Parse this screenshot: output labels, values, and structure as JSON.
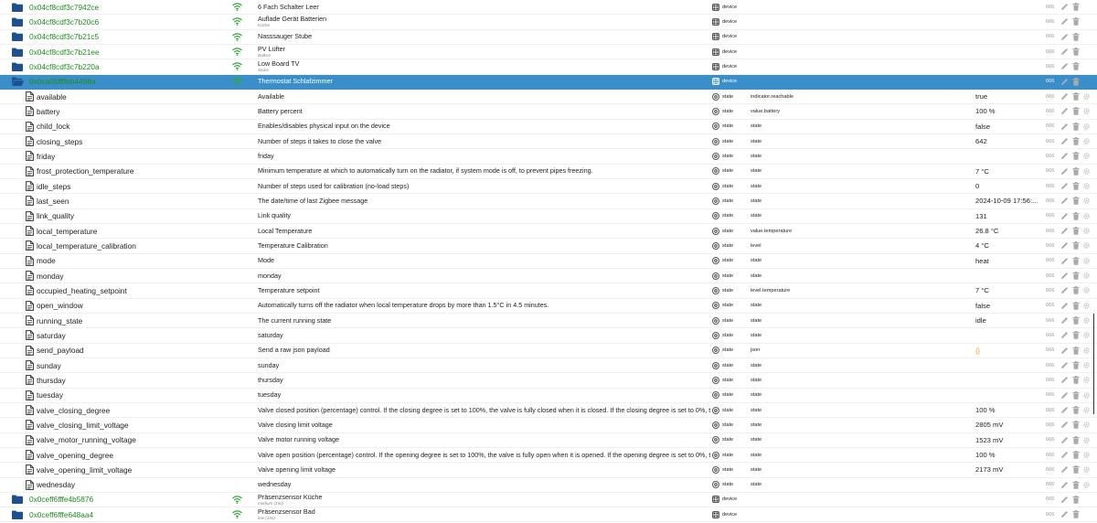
{
  "rows": [
    {
      "kind": "device",
      "icon": "folder-icon",
      "id": "0x04cf8cdf3c7942ce",
      "wifi": true,
      "name": "6 Fach Schalter Leer",
      "sub": "",
      "type": "device",
      "role": "",
      "value": "",
      "acl": "666"
    },
    {
      "kind": "device",
      "icon": "folder-icon",
      "id": "0x04cf8cdf3c7b20c6",
      "wifi": true,
      "name": "Auflade Gerät Batterien",
      "sub": "Küche",
      "type": "device",
      "role": "",
      "value": "",
      "acl": "666"
    },
    {
      "kind": "device",
      "icon": "folder-icon",
      "id": "0x04cf8cdf3c7b21c5",
      "wifi": true,
      "name": "Nasssauger Stube",
      "sub": "",
      "type": "device",
      "role": "",
      "value": "",
      "acl": "666"
    },
    {
      "kind": "device",
      "icon": "folder-icon",
      "id": "0x04cf8cdf3c7b21ee",
      "wifi": true,
      "name": "PV Lüfter",
      "sub": "Balkon",
      "type": "device",
      "role": "",
      "value": "",
      "acl": "666"
    },
    {
      "kind": "device",
      "icon": "folder-icon",
      "id": "0x04cf8cdf3c7b220a",
      "wifi": true,
      "name": "Low Board TV",
      "sub": "Stube",
      "type": "device",
      "role": "",
      "value": "",
      "acl": "666"
    },
    {
      "kind": "device selected",
      "icon": "folder-open-icon",
      "id": "0x0ca05ffffeb4498a",
      "wifi": true,
      "name": "Thermostat Schlafzimmer",
      "sub": "",
      "type": "device",
      "role": "",
      "value": "",
      "acl": "666"
    },
    {
      "kind": "state",
      "icon": "file-icon",
      "id": "available",
      "wifi": false,
      "name": "Available",
      "sub": "",
      "type": "state",
      "role": "indicator.reachable",
      "value": "true",
      "acl": "666"
    },
    {
      "kind": "state",
      "icon": "file-icon",
      "id": "battery",
      "wifi": false,
      "name": "Battery percent",
      "sub": "",
      "type": "state",
      "role": "value.battery",
      "value": "100 %",
      "acl": "666"
    },
    {
      "kind": "state",
      "icon": "file-icon",
      "id": "child_lock",
      "wifi": false,
      "name": "Enables/disables physical input on the device",
      "sub": "",
      "type": "state",
      "role": "state",
      "value": "false",
      "acl": "666"
    },
    {
      "kind": "state",
      "icon": "file-icon",
      "id": "closing_steps",
      "wifi": false,
      "name": "Number of steps it takes to close the valve",
      "sub": "",
      "type": "state",
      "role": "state",
      "value": "642",
      "acl": "666"
    },
    {
      "kind": "state",
      "icon": "file-icon",
      "id": "friday",
      "wifi": false,
      "name": "friday",
      "sub": "",
      "type": "state",
      "role": "state",
      "value": "",
      "acl": "666"
    },
    {
      "kind": "state",
      "icon": "file-icon",
      "id": "frost_protection_temperature",
      "wifi": false,
      "name": "Minimum temperature at which to automatically turn on the radiator, if system mode is off, to prevent pipes freezing.",
      "sub": "",
      "type": "state",
      "role": "state",
      "value": "7 °C",
      "acl": "666"
    },
    {
      "kind": "state",
      "icon": "file-icon",
      "id": "idle_steps",
      "wifi": false,
      "name": "Number of steps used for calibration (no-load steps)",
      "sub": "",
      "type": "state",
      "role": "state",
      "value": "0",
      "acl": "666"
    },
    {
      "kind": "state",
      "icon": "file-icon",
      "id": "last_seen",
      "wifi": false,
      "name": "The date/time of last Zigbee message",
      "sub": "",
      "type": "state",
      "role": "state",
      "value": "2024-10-09 17:56:...",
      "acl": "666"
    },
    {
      "kind": "state",
      "icon": "file-icon",
      "id": "link_quality",
      "wifi": false,
      "name": "Link quality",
      "sub": "",
      "type": "state",
      "role": "state",
      "value": "131",
      "acl": "666"
    },
    {
      "kind": "state",
      "icon": "file-icon",
      "id": "local_temperature",
      "wifi": false,
      "name": "Local Temperature",
      "sub": "",
      "type": "state",
      "role": "value.temperature",
      "value": "26.8 °C",
      "acl": "666"
    },
    {
      "kind": "state",
      "icon": "file-icon",
      "id": "local_temperature_calibration",
      "wifi": false,
      "name": "Temperature Calibration",
      "sub": "",
      "type": "state",
      "role": "level",
      "value": "4 °C",
      "acl": "666"
    },
    {
      "kind": "state",
      "icon": "file-icon",
      "id": "mode",
      "wifi": false,
      "name": "Mode",
      "sub": "",
      "type": "state",
      "role": "state",
      "value": "heat",
      "acl": "666"
    },
    {
      "kind": "state",
      "icon": "file-icon",
      "id": "monday",
      "wifi": false,
      "name": "monday",
      "sub": "",
      "type": "state",
      "role": "state",
      "value": "",
      "acl": "666"
    },
    {
      "kind": "state",
      "icon": "file-icon",
      "id": "occupied_heating_setpoint",
      "wifi": false,
      "name": "Temperature setpoint",
      "sub": "",
      "type": "state",
      "role": "level.temperature",
      "value": "7 °C",
      "acl": "666"
    },
    {
      "kind": "state",
      "icon": "file-icon",
      "id": "open_window",
      "wifi": false,
      "name": "Automatically turns off the radiator when local temperature drops by more than 1.5°C in 4.5 minutes.",
      "sub": "",
      "type": "state",
      "role": "state",
      "value": "false",
      "acl": "666"
    },
    {
      "kind": "state",
      "icon": "file-icon",
      "id": "running_state",
      "wifi": false,
      "name": "The current running state",
      "sub": "",
      "type": "state",
      "role": "state",
      "value": "idle",
      "acl": "666"
    },
    {
      "kind": "state",
      "icon": "file-icon",
      "id": "saturday",
      "wifi": false,
      "name": "saturday",
      "sub": "",
      "type": "state",
      "role": "state",
      "value": "",
      "acl": "666"
    },
    {
      "kind": "state",
      "icon": "file-icon",
      "id": "send_payload",
      "wifi": false,
      "name": "Send a raw json payload",
      "sub": "",
      "type": "state",
      "role": "json",
      "value": "{}",
      "acl": "666"
    },
    {
      "kind": "state",
      "icon": "file-icon",
      "id": "sunday",
      "wifi": false,
      "name": "sunday",
      "sub": "",
      "type": "state",
      "role": "state",
      "value": "",
      "acl": "666"
    },
    {
      "kind": "state",
      "icon": "file-icon",
      "id": "thursday",
      "wifi": false,
      "name": "thursday",
      "sub": "",
      "type": "state",
      "role": "state",
      "value": "",
      "acl": "666"
    },
    {
      "kind": "state",
      "icon": "file-icon",
      "id": "tuesday",
      "wifi": false,
      "name": "tuesday",
      "sub": "",
      "type": "state",
      "role": "state",
      "value": "",
      "acl": "666"
    },
    {
      "kind": "state",
      "icon": "file-icon",
      "id": "valve_closing_degree",
      "wifi": false,
      "name": "Valve closed position (percentage) control. If the closing degree is set to 100%, the valve is fully closed when it is closed. If the closing degree is set to 0%, the ...",
      "sub": "",
      "type": "state",
      "role": "state",
      "value": "100 %",
      "acl": "666"
    },
    {
      "kind": "state",
      "icon": "file-icon",
      "id": "valve_closing_limit_voltage",
      "wifi": false,
      "name": "Valve closing limit voltage",
      "sub": "",
      "type": "state",
      "role": "state",
      "value": "2805 mV",
      "acl": "666"
    },
    {
      "kind": "state",
      "icon": "file-icon",
      "id": "valve_motor_running_voltage",
      "wifi": false,
      "name": "Valve motor running voltage",
      "sub": "",
      "type": "state",
      "role": "state",
      "value": "1523 mV",
      "acl": "666"
    },
    {
      "kind": "state",
      "icon": "file-icon",
      "id": "valve_opening_degree",
      "wifi": false,
      "name": "Valve open position (percentage) control. If the opening degree is set to 100%, the valve is fully open when it is opened. If the opening degree is set to 0%, th...",
      "sub": "",
      "type": "state",
      "role": "state",
      "value": "100 %",
      "acl": "666"
    },
    {
      "kind": "state",
      "icon": "file-icon",
      "id": "valve_opening_limit_voltage",
      "wifi": false,
      "name": "Valve opening limit voltage",
      "sub": "",
      "type": "state",
      "role": "state",
      "value": "2173 mV",
      "acl": "666"
    },
    {
      "kind": "state",
      "icon": "file-icon",
      "id": "wednesday",
      "wifi": false,
      "name": "wednesday",
      "sub": "",
      "type": "state",
      "role": "state",
      "value": "",
      "acl": "666"
    },
    {
      "kind": "device",
      "icon": "folder-icon",
      "id": "0x0ceff6fffe4b5876",
      "wifi": true,
      "name": "Präsenzsensor Küche",
      "sub": "medium (15s)",
      "type": "device",
      "role": "",
      "value": "",
      "acl": "666"
    },
    {
      "kind": "device",
      "icon": "folder-icon",
      "id": "0x0ceff6fffe648aa4",
      "wifi": true,
      "name": "Präsenzsensor Bad",
      "sub": "low (15s)",
      "type": "device",
      "role": "",
      "value": "",
      "acl": "666"
    }
  ],
  "colors": {
    "selected": "#3a8fc9",
    "device_id": "#1e8c1e",
    "folder": "#1d4f91",
    "wifi": "#2eaa2e",
    "json": "#e8a317"
  }
}
